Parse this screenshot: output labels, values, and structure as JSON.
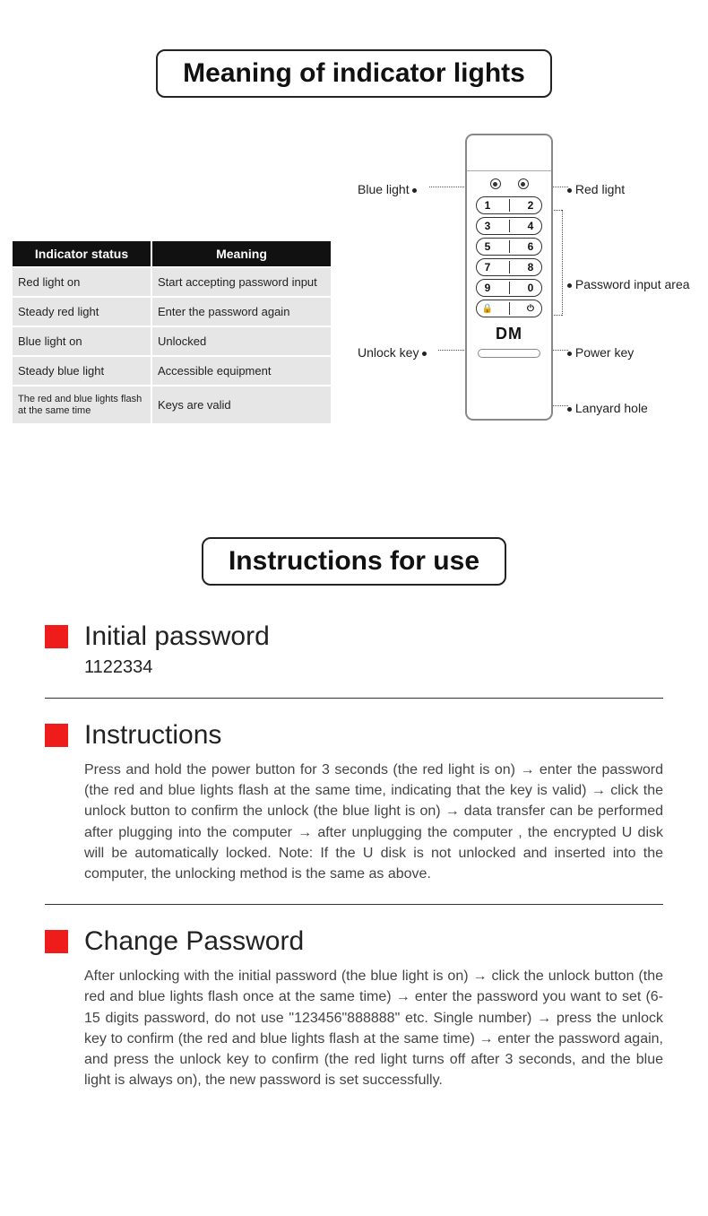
{
  "title1": "Meaning of indicator lights",
  "title2": "Instructions for use",
  "table": {
    "h1": "Indicator status",
    "h2": "Meaning",
    "rows": [
      {
        "status": "Red light on",
        "meaning": "Start accepting password input"
      },
      {
        "status": "Steady red light",
        "meaning": "Enter the password again"
      },
      {
        "status": "Blue light on",
        "meaning": "Unlocked"
      },
      {
        "status": "Steady blue light",
        "meaning": "Accessible equipment"
      },
      {
        "status": "The red and blue lights flash at the same time",
        "meaning": "Keys are valid"
      }
    ]
  },
  "device": {
    "brand": "DM",
    "keys": [
      [
        "1",
        "2"
      ],
      [
        "3",
        "4"
      ],
      [
        "5",
        "6"
      ],
      [
        "7",
        "8"
      ],
      [
        "9",
        "0"
      ]
    ],
    "callouts": {
      "blue": "Blue light",
      "red": "Red light",
      "inputarea": "Password input area",
      "unlock": "Unlock key",
      "power": "Power key",
      "lanyard": "Lanyard hole"
    }
  },
  "sections": {
    "s1": {
      "title": "Initial password",
      "value": "1122334"
    },
    "s2": {
      "title": "Instructions",
      "body": "Press and hold the power button for 3 seconds (the red light is on) → enter the password (the red and blue lights flash at the same time, indicating that the key is valid) → click the unlock button to confirm the unlock (the blue light is on) → data transfer can be performed after plugging into the computer → after unplugging the computer , the encrypted U disk will be automatically locked. Note: If the U disk is not unlocked and inserted into the computer, the unlocking method is the same as above."
    },
    "s3": {
      "title": "Change Password",
      "body": "After unlocking with the initial password (the blue light is on) → click the unlock button (the red and blue lights flash once at the same time) → enter the password you want to set (6-15 digits password, do not use \"123456\"888888\" etc. Single number) → press the unlock key to confirm (the red and blue lights flash at the same time) → enter the password again, and press the unlock key to confirm (the red light turns off after 3 seconds, and the blue light is always on), the new password is set successfully."
    }
  }
}
